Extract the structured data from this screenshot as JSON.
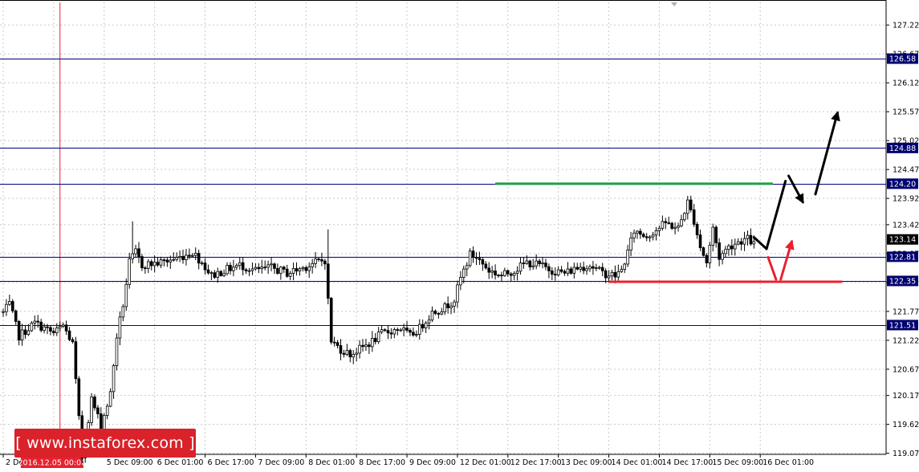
{
  "chart_data": {
    "type": "candlestick",
    "title": "",
    "xlabel": "",
    "ylabel": "",
    "ylim": [
      119.05,
      127.65
    ],
    "grid": true,
    "y_ticks": [
      "127.22",
      "126.67",
      "126.12",
      "125.57",
      "125.02",
      "124.47",
      "123.92",
      "123.42",
      "122.87",
      "122.32",
      "121.77",
      "121.22",
      "120.67",
      "120.17",
      "119.62",
      "119.07"
    ],
    "x_ticks": [
      "2 Dec 01:00",
      "2016.12.05 00:00",
      "5 Dec 09:00",
      "6 Dec 01:00",
      "6 Dec 17:00",
      "7 Dec 09:00",
      "8 Dec 01:00",
      "8 Dec 17:00",
      "9 Dec 09:00",
      "12 Dec 01:00",
      "12 Dec 17:00",
      "13 Dec 09:00",
      "14 Dec 01:00",
      "14 Dec 17:00",
      "15 Dec 09:00",
      "16 Dec 01:00"
    ],
    "levels": [
      {
        "value": 126.58,
        "label": "126.58"
      },
      {
        "value": 124.88,
        "label": "124.88"
      },
      {
        "value": 124.2,
        "label": "124.20"
      },
      {
        "value": 122.81,
        "label": "122.81"
      },
      {
        "value": 122.35,
        "label": "122.35"
      },
      {
        "value": 121.51,
        "label": "121.51"
      }
    ],
    "current_price": {
      "value": 123.14,
      "label": "123.14"
    },
    "anchors": [
      [
        0,
        121.75
      ],
      [
        2,
        121.9
      ],
      [
        5,
        121.3
      ],
      [
        10,
        121.55
      ],
      [
        16,
        121.35
      ],
      [
        19,
        121.5
      ],
      [
        22,
        121.15
      ],
      [
        25,
        119.0
      ],
      [
        28,
        120.1
      ],
      [
        31,
        119.6
      ],
      [
        34,
        120.2
      ],
      [
        36,
        121.3
      ],
      [
        38,
        121.9
      ],
      [
        40,
        122.7
      ],
      [
        42,
        122.9
      ],
      [
        44,
        122.65
      ],
      [
        50,
        122.7
      ],
      [
        56,
        122.8
      ],
      [
        60,
        122.9
      ],
      [
        63,
        122.7
      ],
      [
        66,
        122.45
      ],
      [
        70,
        122.55
      ],
      [
        75,
        122.65
      ],
      [
        80,
        122.55
      ],
      [
        85,
        122.6
      ],
      [
        90,
        122.5
      ],
      [
        95,
        122.6
      ],
      [
        99,
        122.7
      ],
      [
        102,
        122.75
      ],
      [
        104,
        121.2
      ],
      [
        107,
        121.05
      ],
      [
        110,
        120.95
      ],
      [
        113,
        121.05
      ],
      [
        117,
        121.2
      ],
      [
        120,
        121.35
      ],
      [
        126,
        121.45
      ],
      [
        129,
        121.3
      ],
      [
        132,
        121.45
      ],
      [
        136,
        121.75
      ],
      [
        140,
        121.85
      ],
      [
        143,
        122.0
      ],
      [
        145,
        122.4
      ],
      [
        148,
        122.85
      ],
      [
        150,
        122.8
      ],
      [
        154,
        122.55
      ],
      [
        158,
        122.45
      ],
      [
        162,
        122.55
      ],
      [
        166,
        122.7
      ],
      [
        170,
        122.65
      ],
      [
        174,
        122.55
      ],
      [
        178,
        122.5
      ],
      [
        182,
        122.6
      ],
      [
        186,
        122.65
      ],
      [
        190,
        122.5
      ],
      [
        194,
        122.45
      ],
      [
        196,
        122.55
      ],
      [
        198,
        122.9
      ],
      [
        200,
        123.3
      ],
      [
        204,
        123.2
      ],
      [
        210,
        123.45
      ],
      [
        214,
        123.35
      ],
      [
        217,
        123.85
      ],
      [
        219,
        123.5
      ],
      [
        221,
        123.0
      ],
      [
        223,
        122.7
      ],
      [
        225,
        123.35
      ],
      [
        227,
        122.8
      ],
      [
        230,
        123.0
      ],
      [
        233,
        123.1
      ],
      [
        236,
        123.15
      ],
      [
        238,
        123.05
      ]
    ],
    "shapes": {
      "green_segment": {
        "x0": 156,
        "x1": 244,
        "y": 124.2
      },
      "red_segment": {
        "x0": 192,
        "x1": 266,
        "y": 122.35
      },
      "vertical_marker_index": 18
    },
    "forecast_paths": [
      {
        "kind": "black_line",
        "pts": [
          [
            238,
            123.18
          ],
          [
            242,
            122.96
          ]
        ]
      },
      {
        "kind": "black_line",
        "pts": [
          [
            242,
            122.96
          ],
          [
            248,
            124.25
          ]
        ]
      },
      {
        "kind": "black_arrow",
        "pts": [
          [
            249,
            124.35
          ],
          [
            253.5,
            123.85
          ]
        ]
      },
      {
        "kind": "black_arrow",
        "pts": [
          [
            257.5,
            124.0
          ],
          [
            264.5,
            125.55
          ]
        ]
      },
      {
        "kind": "red_line",
        "pts": [
          [
            242.5,
            122.8
          ],
          [
            245,
            122.38
          ]
        ]
      },
      {
        "kind": "red_arrow",
        "pts": [
          [
            246.5,
            122.38
          ],
          [
            250,
            123.1
          ]
        ]
      }
    ],
    "colors": {
      "candle": "#000000",
      "grid": "#c8c8c8",
      "level_line": "#000080",
      "label_bg": "#00006e",
      "current_bg": "#000000",
      "green": "#1f9e4a",
      "red": "#e8212e",
      "marker": "#e8212e"
    }
  },
  "watermark": {
    "text": "[ www.instaforex.com ]"
  }
}
